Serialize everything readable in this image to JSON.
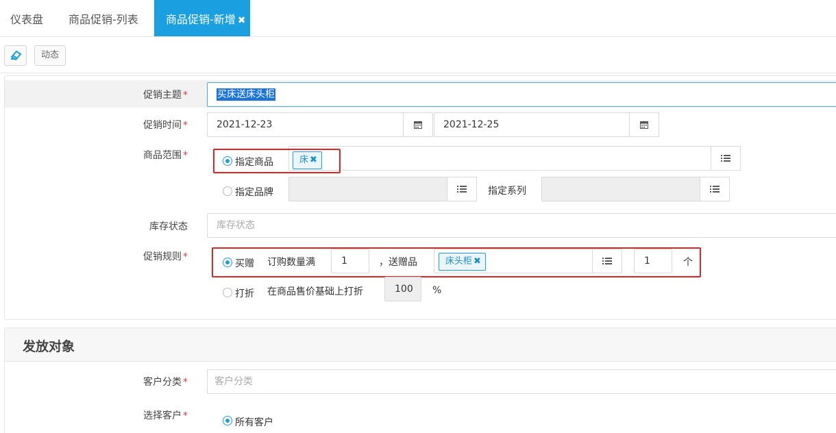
{
  "tabs": [
    {
      "label": "仪表盘"
    },
    {
      "label": "商品促销-列表"
    },
    {
      "label": "商品促销-新增",
      "close": "✖"
    }
  ],
  "toolbar": {
    "eraser_icon": "eraser-icon",
    "dynamic_label": "动态"
  },
  "form": {
    "theme": {
      "label": "促销主题",
      "required": "*",
      "value": "买床送床头柜"
    },
    "time": {
      "label": "促销时间",
      "required": "*",
      "start": "2021-12-23",
      "end": "2021-12-25",
      "icon": "calendar-icon"
    },
    "scope": {
      "label": "商品范围",
      "required": "*",
      "specified_goods": "指定商品",
      "goods_tag": "床",
      "tag_close": "✖",
      "specified_brand": "指定品牌",
      "specified_series": "指定系列",
      "list_icon": "list-icon"
    },
    "stock": {
      "label": "库存状态",
      "placeholder": "库存状态"
    },
    "rule": {
      "label": "促销规则",
      "required": "*",
      "gift_option": "买赠",
      "order_qty_label": "订购数量满",
      "order_qty": "1",
      "gift_label": "，送赠品",
      "gift_tag": "床头柜",
      "gift_tag_close": "✖",
      "gift_count": "1",
      "gift_unit": "个",
      "discount_option": "打折",
      "discount_label": "在商品售价基础上打折",
      "discount_value": "100",
      "discount_unit": "%"
    }
  },
  "section2": {
    "title": "发放对象",
    "customer_category": {
      "label": "客户分类",
      "required": "*",
      "placeholder": "客户分类"
    },
    "select_customer": {
      "label": "选择客户",
      "required": "*",
      "all_customers": "所有客户"
    }
  },
  "colors": {
    "accent": "#1aa0e0",
    "highlight": "#e42222",
    "required": "#e4393c"
  }
}
